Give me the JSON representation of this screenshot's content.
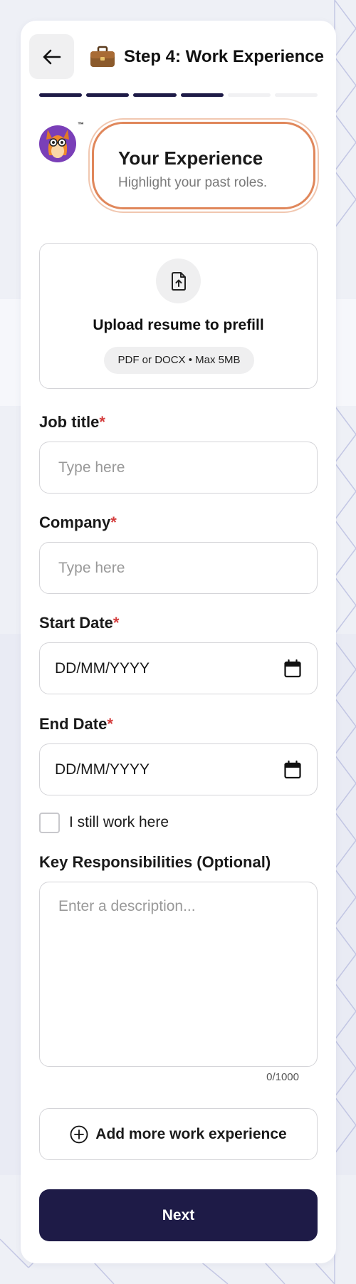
{
  "header": {
    "back_icon": "arrow-left-icon",
    "step_icon": "briefcase-icon",
    "title": "Step 4: Work Experience"
  },
  "progress": {
    "total_steps": 6,
    "completed_steps": 4,
    "active_color": "#1e1b47",
    "inactive_color": "#f1f1f3"
  },
  "mascot": {
    "badge": "™"
  },
  "intro": {
    "title": "Your Experience",
    "subtitle": "Highlight your past roles.",
    "accent": "#e0875b"
  },
  "upload": {
    "icon": "file-upload-icon",
    "title": "Upload resume to prefill",
    "hint": "PDF or DOCX • Max 5MB"
  },
  "form": {
    "job_title": {
      "label": "Job title",
      "required_mark": "*",
      "placeholder": "Type here"
    },
    "company": {
      "label": "Company",
      "required_mark": "*",
      "placeholder": "Type here"
    },
    "start_date": {
      "label": "Start Date",
      "required_mark": "*",
      "value": "DD/MM/YYYY",
      "icon": "calendar-icon"
    },
    "end_date": {
      "label": "End Date",
      "required_mark": "*",
      "value": "DD/MM/YYYY",
      "icon": "calendar-icon"
    },
    "still_working": {
      "label": "I still work here",
      "checked": false
    },
    "responsibilities": {
      "label": "Key Responsibilities (Optional)",
      "placeholder": "Enter a description...",
      "counter": "0/1000"
    }
  },
  "actions": {
    "add_more": {
      "icon": "plus-circle-icon",
      "label": "Add more work experience"
    },
    "next": {
      "label": "Next"
    }
  },
  "colors": {
    "required": "#d43d3d",
    "primary": "#1e1b47"
  }
}
